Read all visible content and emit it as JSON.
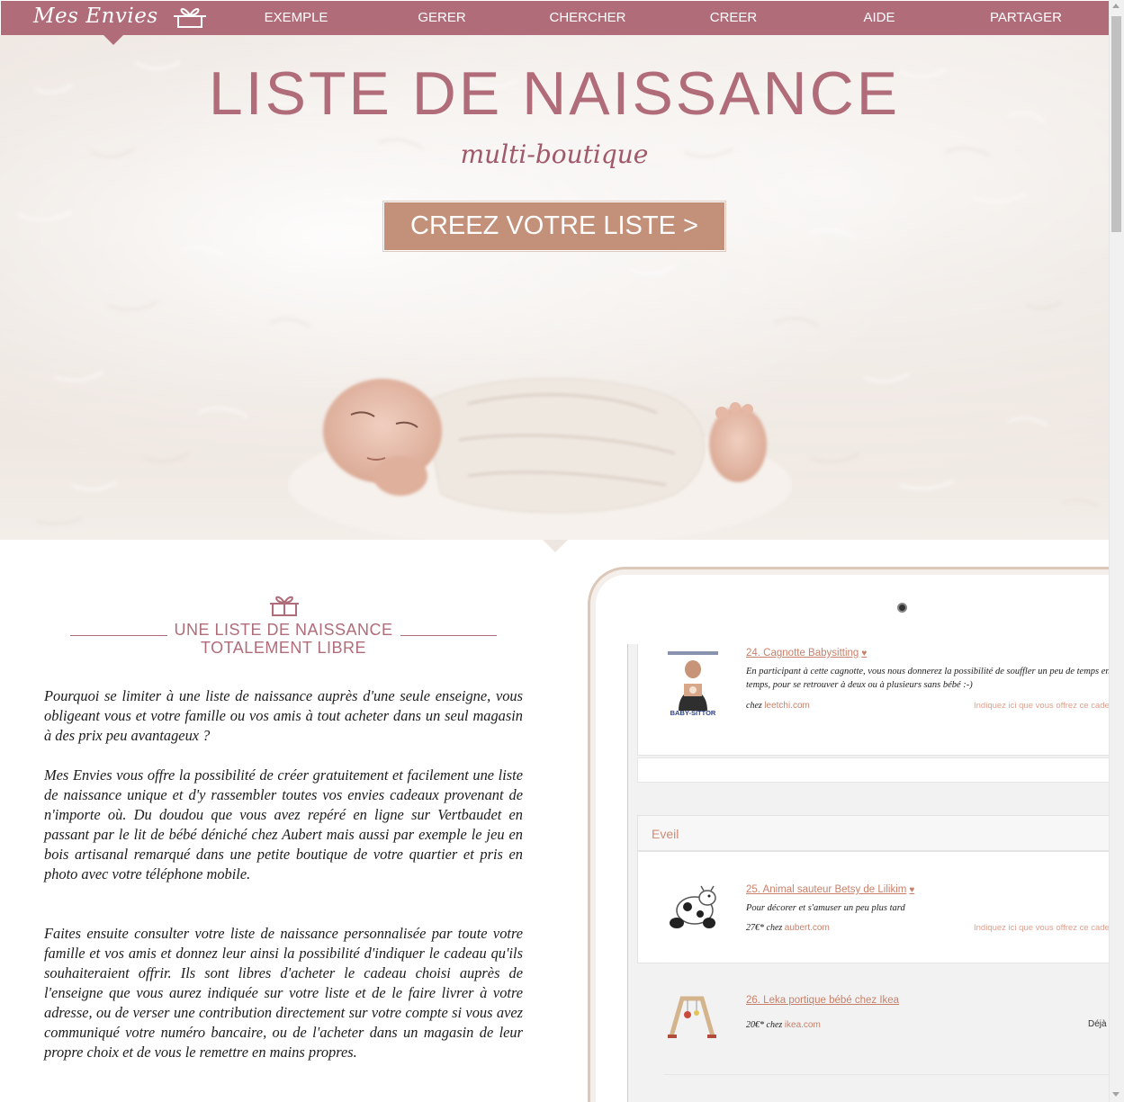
{
  "nav": {
    "logo": "Mes Envies",
    "items": [
      "EXEMPLE",
      "GERER",
      "CHERCHER",
      "CREER",
      "AIDE",
      "PARTAGER"
    ]
  },
  "hero": {
    "title": "LISTE DE NAISSANCE",
    "subtitle": "multi-boutique",
    "cta": "CREEZ VOTRE LISTE >"
  },
  "section": {
    "title_line1": "UNE LISTE DE NAISSANCE",
    "title_line2": "TOTALEMENT LIBRE",
    "paragraphs": [
      "Pourquoi se limiter à une liste de naissance auprès d'une seule enseigne, vous obligeant vous et votre famille ou vos amis à tout acheter dans un seul magasin à des prix peu avantageux ?",
      "Mes Envies vous offre la possibilité de créer gratuitement et facilement une liste de naissance unique et d'y rassembler toutes vos envies cadeaux provenant de n'importe où. Du doudou que vous avez repéré en ligne sur Vertbaudet en passant par le lit de bébé déniché chez Aubert mais aussi par exemple le jeu en bois artisanal remarqué dans une petite boutique de votre quartier et pris en photo avec votre téléphone mobile.",
      "Faites ensuite consulter votre liste de naissance personnalisée par toute votre famille et vos amis et donnez leur ainsi la possibilité d'indiquer le cadeau qu'ils souhaiteraient offrir. Ils sont libres d'acheter le cadeau choisi auprès de l'enseigne que vous aurez indiquée sur votre liste et de le faire livrer à votre adresse, ou de verser une contribution directement sur votre compte si vous avez communiqué votre numéro bancaire, ou de l'acheter dans un magasin de leur propre choix et de vous le remettre en mains propres."
    ]
  },
  "tablet": {
    "group": "Eveil",
    "items": [
      {
        "name": "24. Cagnotte Babysitting",
        "desc": "En participant à cette cagnotte, vous nous donnerez la possibilité de souffler un peu de temps en temps, pour se retrouver à deux ou à plusieurs sans bébé :-)",
        "price": "",
        "chez": "chez",
        "shop": "leetchi.com",
        "offer": "Indiquez ici que vous offrez ce cadeau",
        "image_label": "BABY-SITTOR"
      },
      {
        "name": "25. Animal sauteur Betsy de Lilikim",
        "desc": "Pour décorer et s'amuser un peu plus tard",
        "price": "27€*",
        "chez": "chez",
        "shop": "aubert.com",
        "offer": "Indiquez ici que vous offrez ce cadeau"
      },
      {
        "name": "26. Leka portique bébé chez Ikea",
        "desc": "",
        "price": "20€*",
        "chez": "chez",
        "shop": "ikea.com",
        "offer": "Déjà"
      }
    ]
  },
  "colors": {
    "brand": "#b06c78",
    "cta": "#c3907a",
    "link": "#c7806a"
  }
}
